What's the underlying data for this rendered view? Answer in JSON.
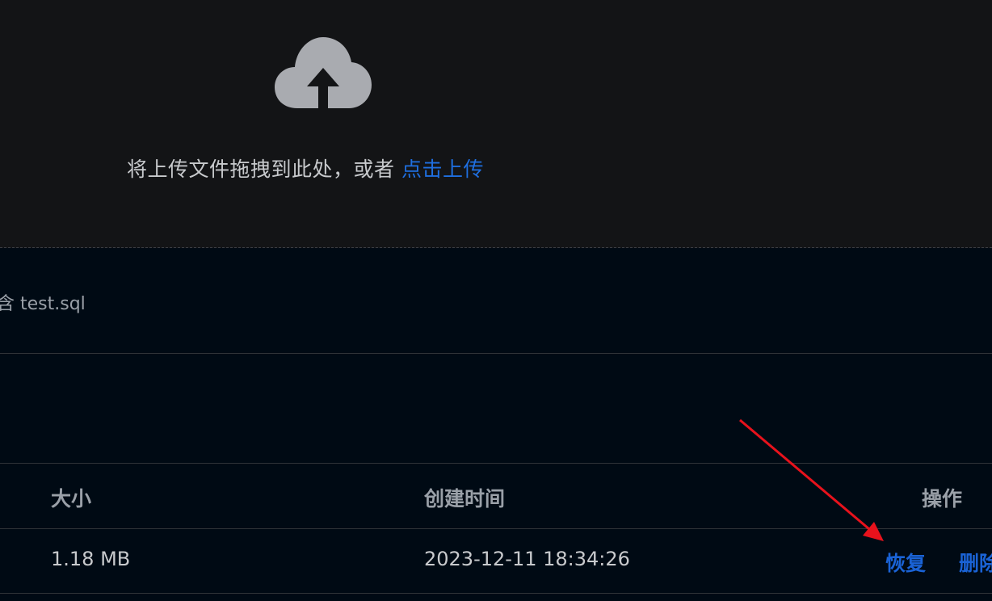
{
  "upload": {
    "icon": "cloud-upload-icon",
    "text": "将上传文件拖拽到此处，或者",
    "link": "点击上传"
  },
  "hint": {
    "text": "含 test.sql"
  },
  "table": {
    "headers": {
      "size": "大小",
      "created": "创建时间",
      "actions": "操作"
    },
    "rows": [
      {
        "size": "1.18 MB",
        "created": "2023-12-11 18:34:26",
        "restore": "恢复",
        "delete": "删除"
      }
    ]
  },
  "colors": {
    "link": "#1a63d6",
    "annotation_arrow": "#e8121c"
  }
}
